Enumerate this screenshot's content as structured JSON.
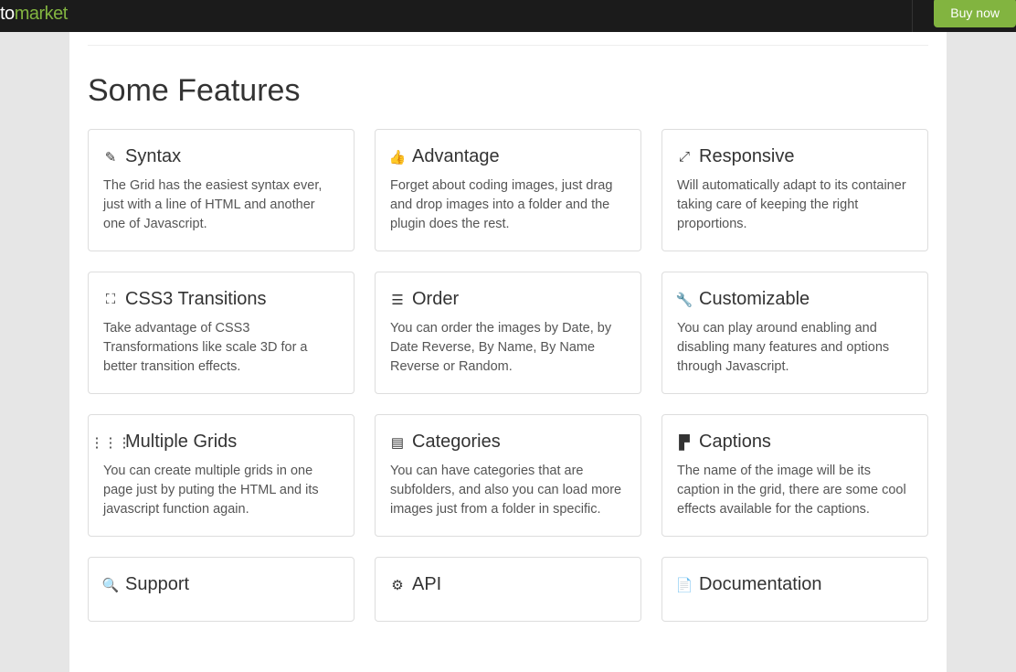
{
  "topbar": {
    "brand_prefix": "to",
    "brand_suffix": "market",
    "buy_label": "Buy now"
  },
  "section": {
    "title": "Some Features"
  },
  "features": [
    {
      "icon": "✎",
      "icon_name": "pencil-icon",
      "title": "Syntax",
      "desc": "The Grid has the easiest syntax ever, just with a line of HTML and another one of Javascript."
    },
    {
      "icon": "👍",
      "icon_name": "thumbs-up-icon",
      "title": "Advantage",
      "desc": "Forget about coding images, just drag and drop images into a folder and the plugin does the rest."
    },
    {
      "icon": "⤢",
      "icon_name": "expand-icon",
      "title": "Responsive",
      "desc": "Will automatically adapt to its container taking care of keeping the right proportions."
    },
    {
      "icon": "⛶",
      "icon_name": "fullscreen-icon",
      "title": "CSS3 Transitions",
      "desc": "Take advantage of CSS3 Transformations like scale 3D for a better transition effects."
    },
    {
      "icon": "☰",
      "icon_name": "list-icon",
      "title": "Order",
      "desc": "You can order the images by Date, by Date Reverse, By Name, By Name Reverse or Random."
    },
    {
      "icon": "🔧",
      "icon_name": "wrench-icon",
      "title": "Customizable",
      "desc": "You can play around enabling and disabling many features and options through Javascript."
    },
    {
      "icon": "⋮⋮⋮",
      "icon_name": "grid-icon",
      "title": "Multiple Grids",
      "desc": "You can create multiple grids in one page just by puting the HTML and its javascript function again."
    },
    {
      "icon": "▤",
      "icon_name": "categories-icon",
      "title": "Categories",
      "desc": "You can have categories that are subfolders, and also you can load more images just from a folder in specific."
    },
    {
      "icon": "▛",
      "icon_name": "caption-icon",
      "title": "Captions",
      "desc": "The name of the image will be its caption in the grid, there are some cool effects available for the captions."
    },
    {
      "icon": "🔍",
      "icon_name": "search-icon",
      "title": "Support",
      "desc": ""
    },
    {
      "icon": "⚙",
      "icon_name": "gear-icon",
      "title": "API",
      "desc": ""
    },
    {
      "icon": "📄",
      "icon_name": "file-icon",
      "title": "Documentation",
      "desc": ""
    }
  ]
}
